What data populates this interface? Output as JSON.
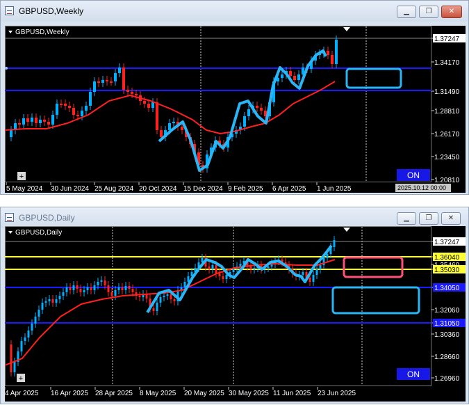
{
  "weekly_window": {
    "title": "GBPUSD,Weekly",
    "chart_label": "GBPUSD,Weekly",
    "price_labels": [
      "1.37247",
      "1.34170",
      "1.31490",
      "1.28810",
      "1.26170",
      "1.23450",
      "1.20810"
    ],
    "current_price": "1.37247",
    "date_labels": [
      "5 May 2024",
      "30 Jun 2024",
      "25 Aug 2024",
      "20 Oct 2024",
      "15 Dec 2024",
      "9 Feb 2025",
      "6 Apr 2025",
      "1 Jun 2025"
    ],
    "crosshair_date": "2025.10.12 00:00",
    "on_badge": "ON",
    "colors": {
      "up": "#00b0ff",
      "down": "#ff2020",
      "ma": "#ff2020",
      "hline": "#1a1aff",
      "annotation": "#29b6f6"
    }
  },
  "daily_window": {
    "title": "GBPUSD,Daily",
    "chart_label": "GBPUSD,Daily",
    "price_labels": [
      "1.37247",
      "1.36040",
      "1.35460",
      "1.35030",
      "1.34050",
      "1.32060",
      "1.31050",
      "1.30360",
      "1.28660",
      "1.26960"
    ],
    "date_labels": [
      "4 Apr 2025",
      "16 Apr 2025",
      "28 Apr 2025",
      "8 May 2025",
      "20 May 2025",
      "30 May 2025",
      "11 Jun 2025",
      "23 Jun 2025"
    ],
    "on_badge": "ON",
    "colors": {
      "yellow": "#ffff33",
      "pink_box": "#ff4f7b",
      "blue_box": "#29b6f6"
    }
  },
  "window_buttons": {
    "minimize": "▁",
    "restore": "❐",
    "close": "✕"
  }
}
